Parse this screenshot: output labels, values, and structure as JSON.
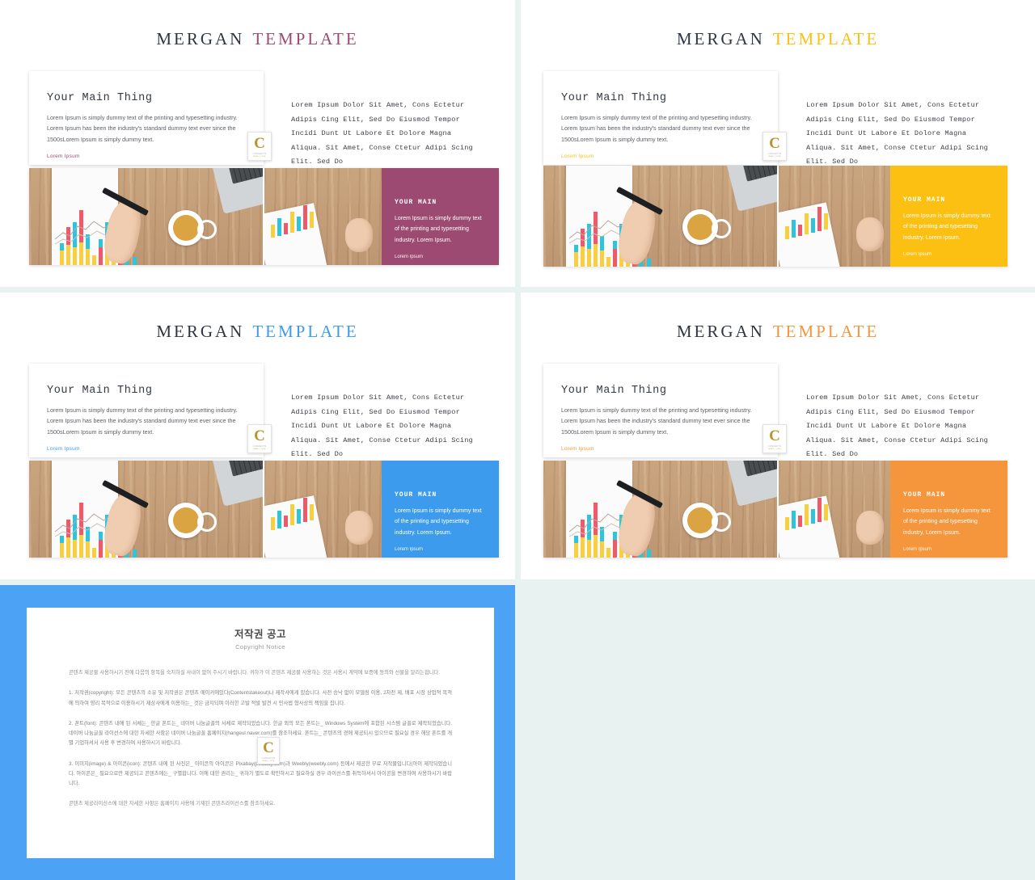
{
  "palette": {
    "background": "#e7f2f1",
    "slide_bg": "#ffffff",
    "brand_dark": "#2f3640",
    "accent_mauve": "#9c4a72",
    "accent_yellow": "#fbc012",
    "accent_blue": "#3d9bed",
    "accent_orange": "#f5963c",
    "frame_blue": "#4ca3f5",
    "logo_gold": "#b8942f"
  },
  "slides": [
    {
      "id": "slide-1",
      "title_brand": "MERGAN",
      "title_accent": "TEMPLATE",
      "accent": "#9c4a72",
      "card": {
        "heading": "Your Main Thing",
        "body": "Lorem Ipsum is simply dummy text of the printing and typesetting industry. Lorem Ipsum has been the industry's standard dummy text ever since the 1500sLorem Ipsum is simply dummy text.",
        "link": "Lorem Ipsum"
      },
      "mono_lines": [
        "Lorem Ipsum Dolor Sit Amet, Cons Ectetur",
        "Adipis Cing Elit, Sed Do Eiusmod Tempor",
        "Incidi Dunt Ut Labore Et Dolore Magna",
        "Aliqua. Sit Amet, Conse Ctetur Adipi Scing",
        "Elit. Sed Do"
      ],
      "panel": {
        "heading": "YOUR MAIN",
        "body": "Lorem Ipsum is simply dummy text of the printing and typesetting industry. Lorem Ipsum.",
        "link": "Lorem Ipsum"
      }
    },
    {
      "id": "slide-2",
      "title_brand": "MERGAN",
      "title_accent": "TEMPLATE",
      "accent": "#fbc012",
      "card": {
        "heading": "Your Main Thing",
        "body": "Lorem Ipsum is simply dummy text of the printing and typesetting industry. Lorem Ipsum has been the industry's standard dummy text ever since the 1500sLorem Ipsum is simply dummy text.",
        "link": "Lorem Ipsum"
      },
      "mono_lines": [
        "Lorem Ipsum Dolor Sit Amet, Cons Ectetur",
        "Adipis Cing Elit, Sed Do Eiusmod Tempor",
        "Incidi Dunt Ut Labore Et Dolore Magna",
        "Aliqua. Sit Amet, Conse Ctetur Adipi Scing",
        "Elit. Sed Do"
      ],
      "panel": {
        "heading": "YOUR MAIN",
        "body": "Lorem Ipsum is simply dummy text of the printing and typesetting industry. Lorem Ipsum.",
        "link": "Lorem Ipsum"
      }
    },
    {
      "id": "slide-3",
      "title_brand": "MERGAN",
      "title_accent": "TEMPLATE",
      "accent": "#3d9bed",
      "card": {
        "heading": "Your Main Thing",
        "body": "Lorem Ipsum is simply dummy text of the printing and typesetting industry. Lorem Ipsum has been the industry's standard dummy text ever since the 1500sLorem Ipsum is simply dummy text.",
        "link": "Lorem Ipsum"
      },
      "mono_lines": [
        "Lorem Ipsum Dolor Sit Amet, Cons Ectetur",
        "Adipis Cing Elit, Sed Do Eiusmod Tempor",
        "Incidi Dunt Ut Labore Et Dolore Magna",
        "Aliqua. Sit Amet, Conse Ctetur Adipi Scing",
        "Elit. Sed Do"
      ],
      "panel": {
        "heading": "YOUR MAIN",
        "body": "Lorem Ipsum is simply dummy text of the printing and typesetting industry. Lorem Ipsum.",
        "link": "Lorem Ipsum"
      }
    },
    {
      "id": "slide-4",
      "title_brand": "MERGAN",
      "title_accent": "TEMPLATE",
      "accent": "#f5963c",
      "card": {
        "heading": "Your Main Thing",
        "body": "Lorem Ipsum is simply dummy text of the printing and typesetting industry. Lorem Ipsum has been the industry's standard dummy text ever since the 1500sLorem Ipsum is simply dummy text.",
        "link": "Lorem Ipsum"
      },
      "mono_lines": [
        "Lorem Ipsum Dolor Sit Amet, Cons Ectetur",
        "Adipis Cing Elit, Sed Do Eiusmod Tempor",
        "Incidi Dunt Ut Labore Et Dolore Magna",
        "Aliqua. Sit Amet, Conse Ctetur Adipi Scing",
        "Elit. Sed Do"
      ],
      "panel": {
        "heading": "YOUR MAIN",
        "body": "Lorem Ipsum is simply dummy text of the printing and typesetting industry. Lorem Ipsum.",
        "link": "Lorem Ipsum"
      }
    }
  ],
  "logo": {
    "letter": "C",
    "sub": "CONCEPTS",
    "sub2": "REAL | LIFE"
  },
  "copyright": {
    "title": "저작권 공고",
    "subtitle": "Copyright Notice",
    "intro": "콘텐츠 제공물 사용하시기 전에 다음의 항목을 숙지하실 사내이 없어 주시기 바랍니다. 귀하가 이 콘텐츠 제공물 사용하는 것은 사용시 계약에 보증에 동의와 선물을 알리는합니다.",
    "item1": "1. 저작권(copyright): 모든 콘텐츠의 소유 및 저작권은 콘텐츠 메이커에있다(Contentstakeout)나 제작사에게 있습니다. 사전 승낙 없이 모델링 이용, 2차전 제, 배포 시장 상업적 목적에 의하여 영리 목적으로 이용하시기 제삼사에게 이용하는_ 것은 금지되며 이러한 고발 적발 발견 시 민사법 형사상의 책임을 집니다.",
    "item2": "2. 폰트(font): 콘텐츠 내에 된 서체는_ 한글 폰트는_ 네이버 나눔글꼴의 서체로 제작되었습니다. 한글 외의 모든 폰트는_ Windows System에 포함된 시스템 글꼴로 제작되었습니다. 네이버 나눔글꼴 라이선스에 대한 자세한 사항은 네이버 나눔글꼴 홈페이지(hangeul.naver.com)를 참조하세요. 폰트는_ 콘텐츠의 경에 제공되시 있으므로 필요실 경우 해당 폰트를 개별 기업하셔서 사용 후 변경하여 사용하시기 바랍니다.",
    "item3": "3. 이미지(image) & 아이콘(icon): 콘텐츠 내에 된 사진은_ 아이콘의 아이콘은 Pixabay(pixabay.com)과 Weebly(weebly.com) 등에서 제공한 무료 저작물입니다(아이 제작되었습니다. 아이콘은_ 필요으로만 제공되고 콘텐츠에는_ 구별합니다. 이에 대한 권리는_ 귀하가 별도로 확인하시고 필요하실 경우 라이선스를 취득하셔서 아이콘을 변경하여 사용하시기 바랍니다.",
    "footer": "콘텐츠 제공라이선스에 대한 자세한 사항은 홈페이지 사용에 기재된 콘텐츠라이선스를 참조하세요."
  }
}
